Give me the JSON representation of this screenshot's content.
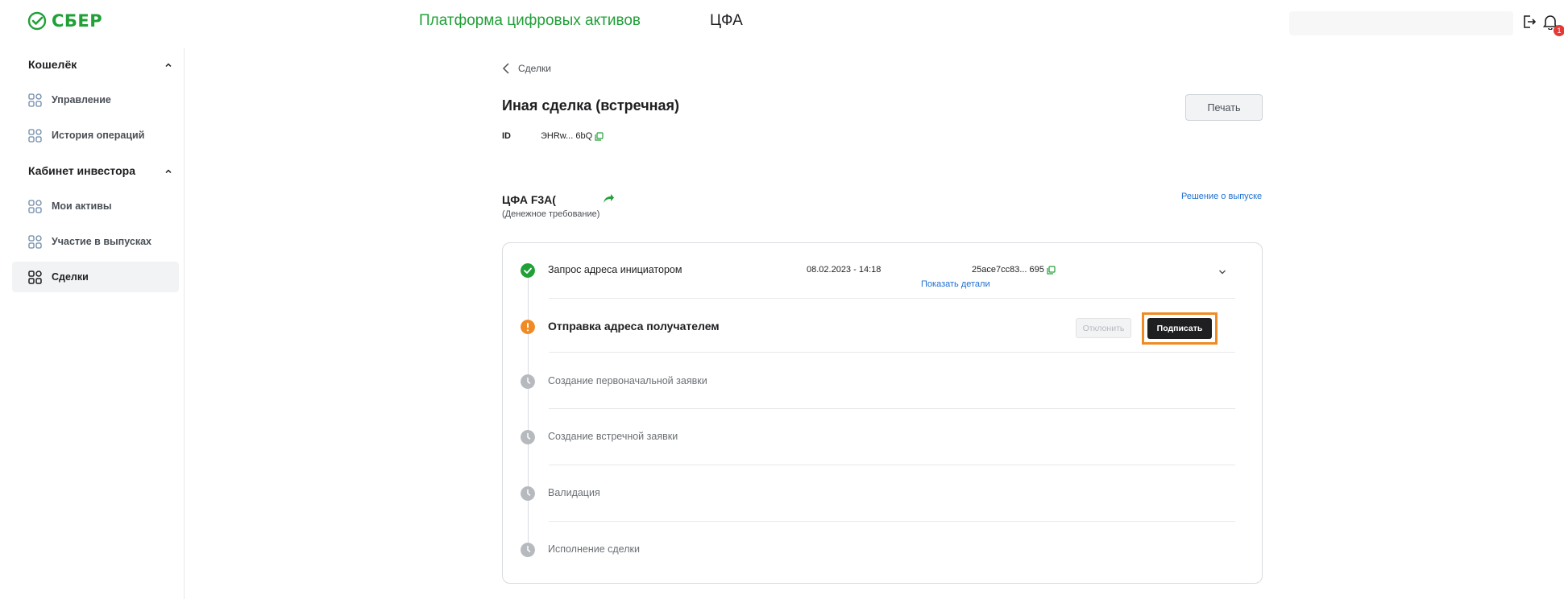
{
  "header": {
    "logo_text": "СБЕР",
    "platform_title": "Платформа цифровых активов",
    "section_title": "ЦФА",
    "notifications_count": "1",
    "brand_color": "#21a038"
  },
  "sidebar": {
    "sections": [
      {
        "title": "Кошелёк",
        "items": [
          {
            "label": "Управление",
            "icon": "grid-icon"
          },
          {
            "label": "История операций",
            "icon": "grid-icon"
          }
        ]
      },
      {
        "title": "Кабинет инвестора",
        "items": [
          {
            "label": "Мои активы",
            "icon": "grid-icon"
          },
          {
            "label": "Участие в выпусках",
            "icon": "grid-icon"
          },
          {
            "label": "Сделки",
            "icon": "grid-icon",
            "active": true
          }
        ]
      }
    ]
  },
  "main": {
    "back_label": "Сделки",
    "title": "Иная сделка (встречная)",
    "print_label": "Печать",
    "id_label": "ID",
    "id_value": "ЭHRw... 6bQ",
    "cfa_name": "ЦФА F3A(",
    "cfa_type": "(Денежное требование)",
    "release_link": "Решение о выпуске"
  },
  "steps": [
    {
      "label": "Запрос адреса инициатором",
      "status": "done",
      "date": "08.02.2023 - 14:18",
      "hash": "25ace7cc83... 695",
      "details_link": "Показать детали"
    },
    {
      "label": "Отправка адреса получателем",
      "status": "current",
      "reject_label": "Отклонить",
      "sign_label": "Подписать"
    },
    {
      "label": "Создание первоначальной заявки",
      "status": "pending"
    },
    {
      "label": "Создание встречной заявки",
      "status": "pending"
    },
    {
      "label": "Валидация",
      "status": "pending"
    },
    {
      "label": "Исполнение сделки",
      "status": "pending"
    }
  ],
  "colors": {
    "done": "#21a038",
    "current": "#f08a24",
    "pending": "#b6b9bd",
    "link": "#1c6fd1",
    "highlight": "#f08a24"
  }
}
